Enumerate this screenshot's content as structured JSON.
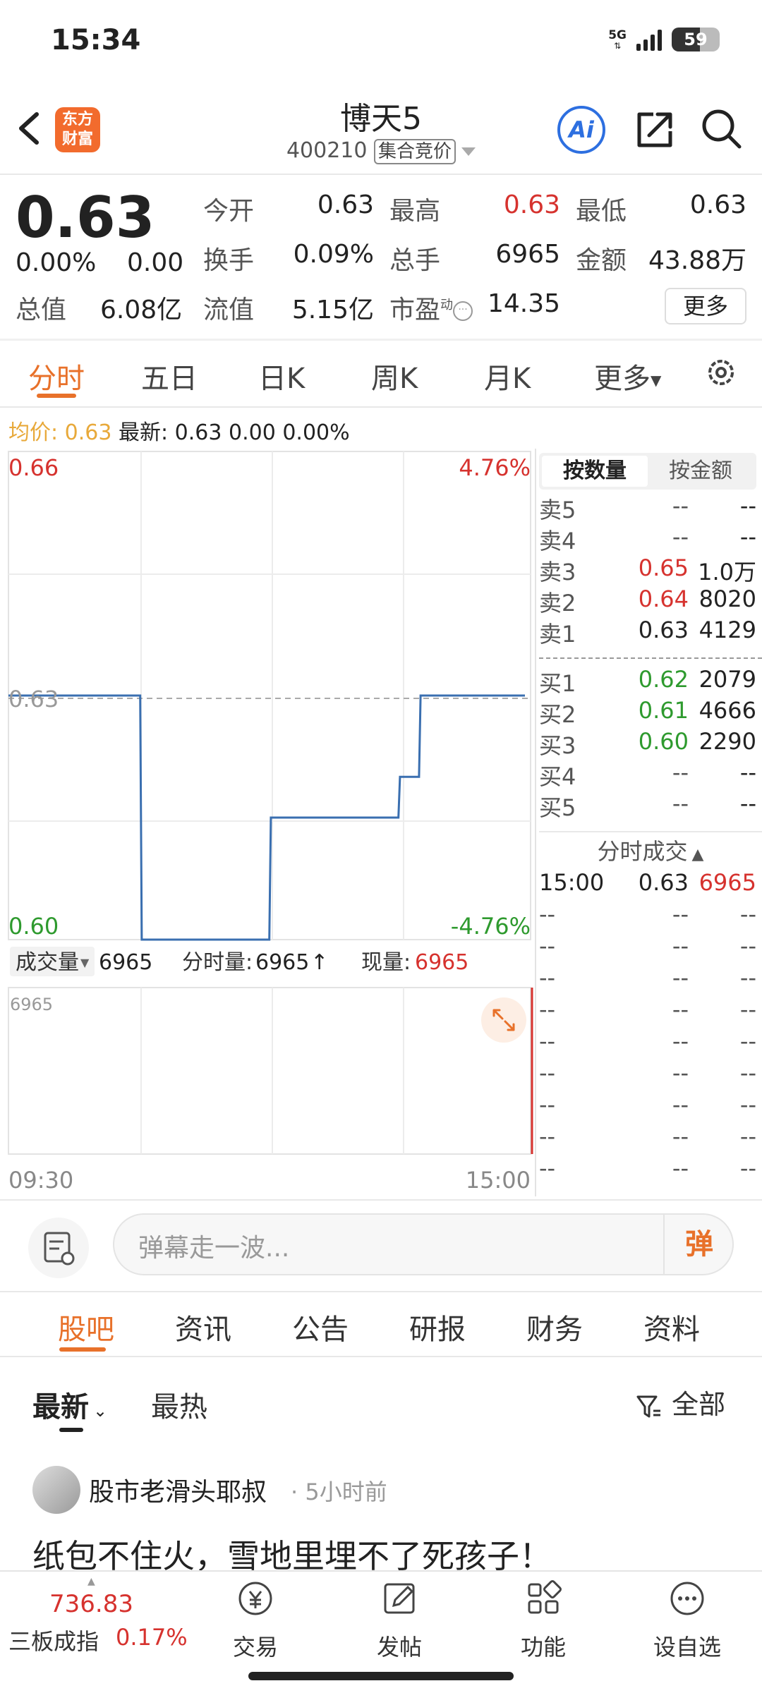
{
  "status_bar": {
    "time": "15:34",
    "network": "5G",
    "battery": "59"
  },
  "header": {
    "app_logo": "东方财富",
    "title": "博天5",
    "code": "400210",
    "tag": "集合竞价",
    "ai_label": "Ai"
  },
  "quote": {
    "price": "0.63",
    "change_pct": "0.00%",
    "change": "0.00",
    "market_value_label": "总值",
    "market_value": "6.08亿",
    "fields": [
      {
        "label": "今开",
        "value": "0.63"
      },
      {
        "label": "最高",
        "value": "0.63",
        "color": "red"
      },
      {
        "label": "最低",
        "value": "0.63"
      },
      {
        "label": "换手",
        "value": "0.09%"
      },
      {
        "label": "总手",
        "value": "6965"
      },
      {
        "label": "金额",
        "value": "43.88万"
      },
      {
        "label": "流值",
        "value": "5.15亿"
      },
      {
        "label": "市盈",
        "label_sup": "动",
        "value": "14.35"
      }
    ],
    "more_label": "更多"
  },
  "chart_tabs": [
    "分时",
    "五日",
    "日K",
    "周K",
    "月K",
    "更多"
  ],
  "avg_row": {
    "avg_label": "均价:",
    "avg_value": "0.63",
    "latest_label": "最新:",
    "latest_value": "0.63",
    "latest_change": "0.00",
    "latest_pct": "0.00%"
  },
  "chart_data": {
    "type": "line",
    "y_top_label": "0.66",
    "y_mid_label": "0.63",
    "y_bottom_label": "0.60",
    "pct_top_label": "4.76%",
    "pct_bottom_label": "-4.76%",
    "ylim": [
      0.6,
      0.66
    ],
    "prev_close": 0.63,
    "x_start_label": "09:30",
    "x_end_label": "15:00",
    "price_series": [
      {
        "t": 0.0,
        "v": 0.63
      },
      {
        "t": 0.255,
        "v": 0.63
      },
      {
        "t": 0.258,
        "v": 0.6
      },
      {
        "t": 0.505,
        "v": 0.6
      },
      {
        "t": 0.508,
        "v": 0.615
      },
      {
        "t": 0.755,
        "v": 0.615
      },
      {
        "t": 0.758,
        "v": 0.62
      },
      {
        "t": 0.795,
        "v": 0.62
      },
      {
        "t": 0.798,
        "v": 0.63
      },
      {
        "t": 1.0,
        "v": 0.63
      }
    ],
    "volume_label": "成交量",
    "volume_total": "6965",
    "period_volume_label": "分时量:",
    "period_volume": "6965",
    "current_volume_label": "现量:",
    "current_volume": "6965",
    "volume_axis_max": "6965"
  },
  "orderbook": {
    "tabs": [
      "按数量",
      "按金额"
    ],
    "asks": [
      {
        "label": "卖5",
        "price": "--",
        "vol": "--",
        "color": "grey"
      },
      {
        "label": "卖4",
        "price": "--",
        "vol": "--",
        "color": "grey"
      },
      {
        "label": "卖3",
        "price": "0.65",
        "vol": "1.0万",
        "color": "red"
      },
      {
        "label": "卖2",
        "price": "0.64",
        "vol": "8020",
        "color": "red"
      },
      {
        "label": "卖1",
        "price": "0.63",
        "vol": "4129",
        "color": "black"
      }
    ],
    "bids": [
      {
        "label": "买1",
        "price": "0.62",
        "vol": "2079",
        "color": "green"
      },
      {
        "label": "买2",
        "price": "0.61",
        "vol": "4666",
        "color": "green"
      },
      {
        "label": "买3",
        "price": "0.60",
        "vol": "2290",
        "color": "green"
      },
      {
        "label": "买4",
        "price": "--",
        "vol": "--",
        "color": "grey"
      },
      {
        "label": "买5",
        "price": "--",
        "vol": "--",
        "color": "grey"
      }
    ],
    "trades_title": "分时成交",
    "trades": [
      {
        "time": "15:00",
        "price": "0.63",
        "vol": "6965"
      },
      {
        "time": "--",
        "price": "--",
        "vol": "--"
      },
      {
        "time": "--",
        "price": "--",
        "vol": "--"
      },
      {
        "time": "--",
        "price": "--",
        "vol": "--"
      },
      {
        "time": "--",
        "price": "--",
        "vol": "--"
      },
      {
        "time": "--",
        "price": "--",
        "vol": "--"
      },
      {
        "time": "--",
        "price": "--",
        "vol": "--"
      },
      {
        "time": "--",
        "price": "--",
        "vol": "--"
      },
      {
        "time": "--",
        "price": "--",
        "vol": "--"
      },
      {
        "time": "--",
        "price": "--",
        "vol": "--"
      }
    ]
  },
  "danmaku": {
    "placeholder": "弹幕走一波...",
    "button": "弹"
  },
  "bottom_tabs": [
    "股吧",
    "资讯",
    "公告",
    "研报",
    "财务",
    "资料"
  ],
  "feed": {
    "sort_newest": "最新",
    "sort_hot": "最热",
    "filter": "全部",
    "post": {
      "author": "股市老滑头耶叔",
      "time": "5小时前",
      "text": "纸包不住火，雪地里埋不了死孩子！"
    }
  },
  "bottom_nav": {
    "index_value": "736.83",
    "index_name": "三板成指",
    "index_pct": "0.17%",
    "items": [
      "交易",
      "发帖",
      "功能",
      "设自选"
    ]
  },
  "colors": {
    "accent": "#e8712a",
    "up": "#d6322e",
    "down": "#2e9a2e",
    "line": "#3a6fb0"
  }
}
